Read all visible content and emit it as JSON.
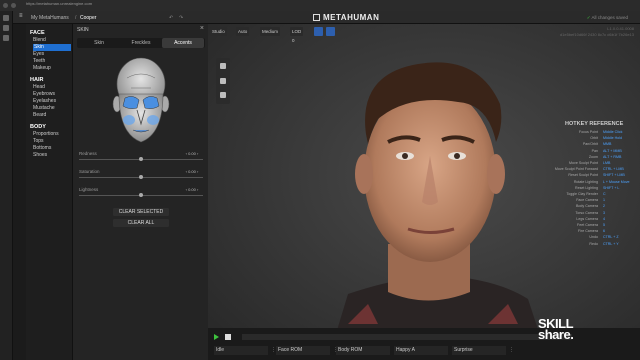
{
  "browser": {
    "url": "https://metahuman.unrealengine.com"
  },
  "app": {
    "breadcrumb_root": "My MetaHumans",
    "breadcrumb_sep": "/",
    "breadcrumb_current": "Cooper",
    "logo": "METAHUMAN",
    "status": "All changes saved"
  },
  "sidebar": {
    "sections": [
      {
        "title": "FACE",
        "items": [
          "Blend",
          "Skin",
          "Eyes",
          "Teeth",
          "Makeup"
        ]
      },
      {
        "title": "HAIR",
        "items": [
          "Head",
          "Eyebrows",
          "Eyelashes",
          "Mustache",
          "Beard"
        ]
      },
      {
        "title": "BODY",
        "items": [
          "Proportions",
          "Tops",
          "Bottoms",
          "Shoes"
        ]
      }
    ],
    "active_item": "Skin"
  },
  "panel": {
    "title": "SKIN",
    "close": "×",
    "tabs": [
      "Skin",
      "Freckles",
      "Accents"
    ],
    "active_tab": "Accents",
    "sliders": [
      {
        "label": "Redness",
        "value": "0.00",
        "level": 0.5
      },
      {
        "label": "Saturation",
        "value": "0.00",
        "level": 0.5
      },
      {
        "label": "Lightness",
        "value": "0.00",
        "level": 0.5
      }
    ],
    "buttons": {
      "clear_selected": "CLEAR SELECTED",
      "clear_all": "CLEAR ALL"
    },
    "highlight_color": "#4a8fe0"
  },
  "viewport": {
    "toolbar": [
      "Studio",
      "Auto",
      "Medium",
      "LOD 0"
    ],
    "coords": [
      "L1.0.0.41.0008",
      "d1e5bef10d66f 2430 8c7c d6b1f 7b26e13"
    ],
    "hotkeys": {
      "title": "HOTKEY REFERENCE",
      "rows": [
        {
          "key": "Focus Point",
          "val": "Middle Click"
        },
        {
          "key": "Orbit",
          "val": "Middle Hold"
        },
        {
          "key": "Pan/Orbit",
          "val": "MMB"
        },
        {
          "key": "Pan",
          "val": "ALT + MMB"
        },
        {
          "key": "Zoom",
          "val": "ALT + RMB"
        },
        {
          "key": "Move Sculpt Point",
          "val": "LMB"
        },
        {
          "key": "Move Sculpt Point Forward",
          "val": "CTRL + LMB"
        },
        {
          "key": "Reset Sculpt Point",
          "val": "SHIFT + LMB"
        },
        {
          "key": "Rotate Lighting",
          "val": "L + Mouse Move"
        },
        {
          "key": "Reset Lighting",
          "val": "SHIFT + L"
        },
        {
          "key": "Toggle Clay Render",
          "val": "C"
        },
        {
          "key": "Face Camera",
          "val": "1"
        },
        {
          "key": "Body Camera",
          "val": "2"
        },
        {
          "key": "Torso Camera",
          "val": "3"
        },
        {
          "key": "Legs Camera",
          "val": "4"
        },
        {
          "key": "Feet Camera",
          "val": "5"
        },
        {
          "key": "Fire Camera",
          "val": "6"
        },
        {
          "key": "Undo",
          "val": "CTRL + Z"
        },
        {
          "key": "Redo",
          "val": "CTRL + Y"
        }
      ]
    },
    "animations": [
      "Idle",
      "Face ROM",
      "Body ROM",
      "Happy A",
      "Surprise"
    ]
  },
  "watermark": {
    "line1": "SKILL",
    "line2": "share."
  }
}
